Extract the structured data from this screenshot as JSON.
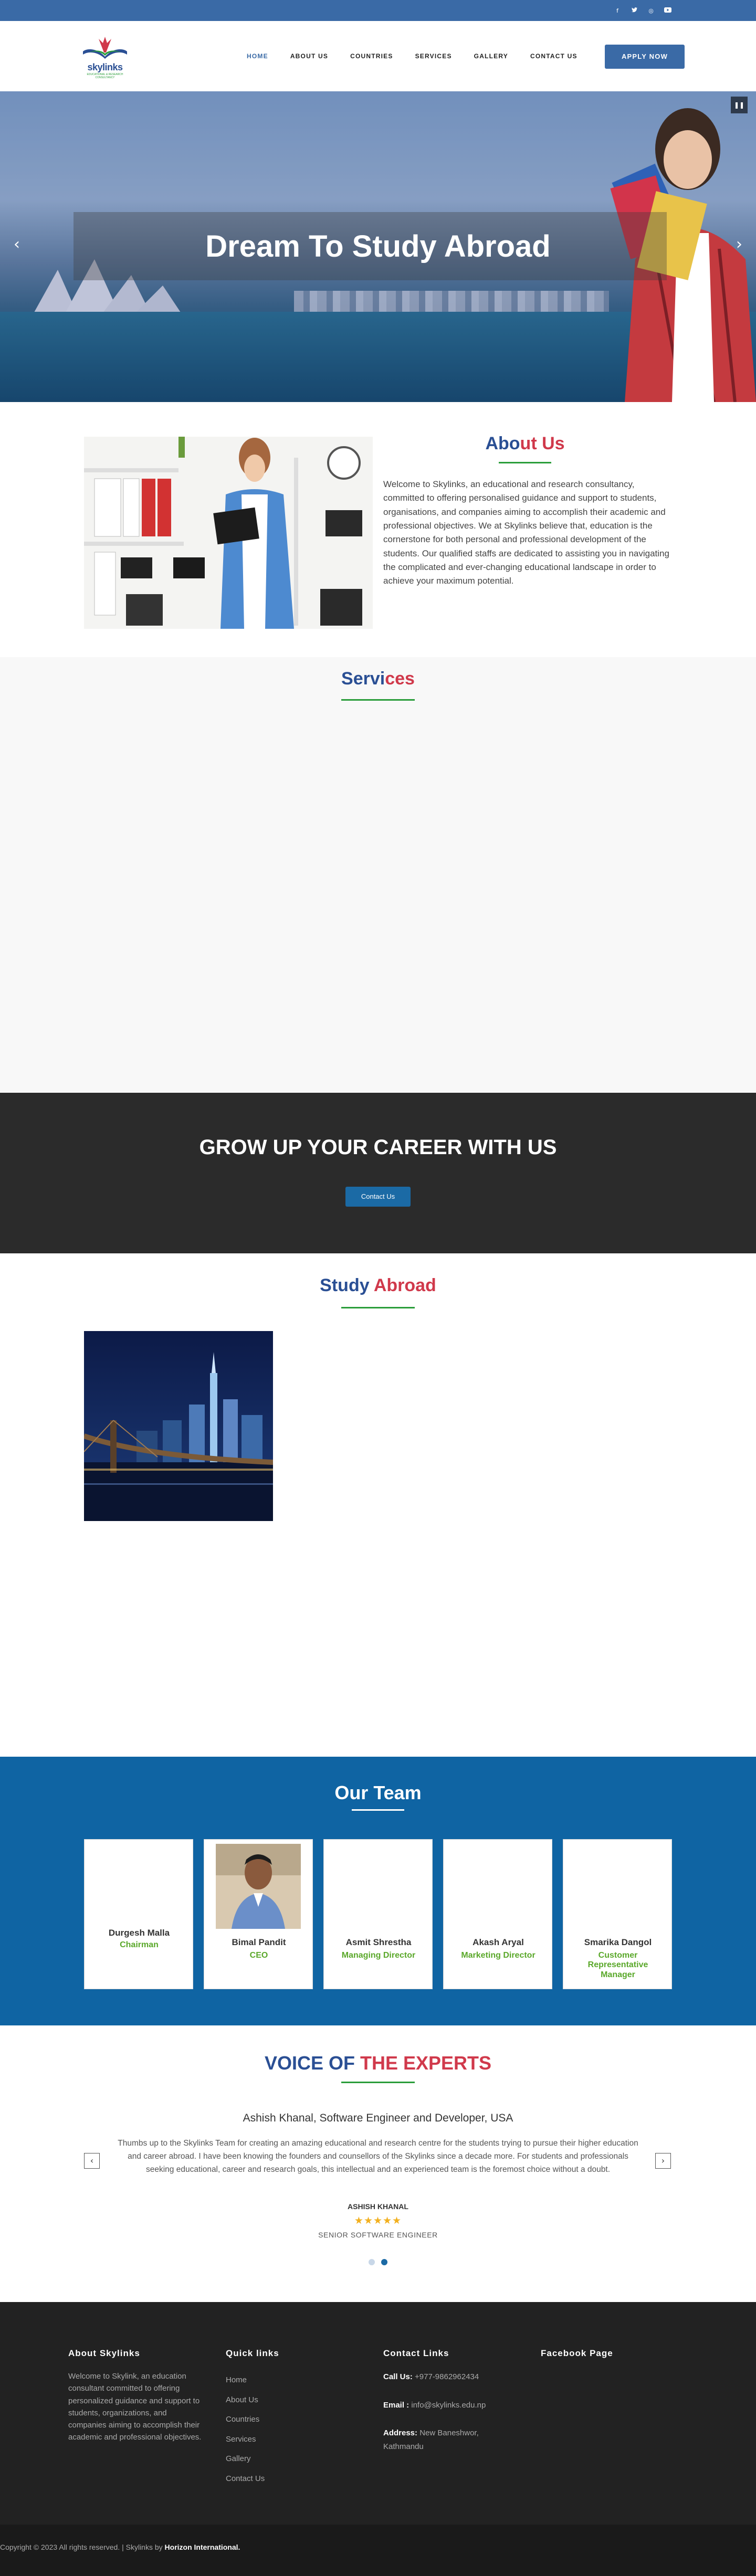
{
  "topbar": {
    "socials": [
      {
        "icon": "facebook-icon",
        "glyph": "f"
      },
      {
        "icon": "twitter-icon",
        "glyph": "🐦"
      },
      {
        "icon": "instagram-icon",
        "glyph": "◎"
      },
      {
        "icon": "youtube-icon",
        "glyph": "▶"
      }
    ]
  },
  "header": {
    "logo_text": "skylinks",
    "logo_subtext": "EDUCATIONAL & RESEARCH CONSULTANCY",
    "nav": [
      {
        "label": "HOME"
      },
      {
        "label": "ABOUT US"
      },
      {
        "label": "COUNTRIES"
      },
      {
        "label": "SERVICES"
      },
      {
        "label": "GALLERY"
      },
      {
        "label": "CONTACT US"
      }
    ],
    "apply_label": "APPLY NOW"
  },
  "hero": {
    "title": "Dream To Study Abroad",
    "prev_glyph": "‹",
    "next_glyph": "›",
    "pause_glyph": "❚❚"
  },
  "about": {
    "title_a": "Abo",
    "title_b": "ut Us",
    "text": "Welcome to Skylinks, an educational and research consultancy, committed to offering personalised guidance and support to students, organisations, and companies aiming to accomplish their academic and professional objectives. We at Skylinks believe that, education is the cornerstone for both personal and professional development of the students. Our qualified staffs are dedicated to assisting you in navigating the complicated and ever-changing educational landscape in order to achieve your maximum potential."
  },
  "services": {
    "title_a": "Servi",
    "title_b": "ces"
  },
  "cta": {
    "title": "GROW UP YOUR CAREER WITH US",
    "button": "Contact Us"
  },
  "study": {
    "title_a": "Study ",
    "title_b": "Abroad"
  },
  "team": {
    "title": "Our Team",
    "members": [
      {
        "name": "Durgesh Malla",
        "role": "Chairman"
      },
      {
        "name": "Bimal Pandit",
        "role": "CEO"
      },
      {
        "name": "Asmit Shrestha",
        "role": "Managing Director"
      },
      {
        "name": "Akash Aryal",
        "role": "Marketing Director"
      },
      {
        "name": "Smarika Dangol",
        "role": "Customer Representative Manager"
      }
    ]
  },
  "voice": {
    "title_a": "VOICE OF ",
    "title_b": "THE EXPERTS",
    "name": "Ashish Khanal, Software Engineer and Developer, USA",
    "text": "Thumbs up to the Skylinks Team for creating an amazing educational and research centre for the students trying to pursue their higher education and career abroad. I have been knowing the founders and counsellors of the Skylinks since a decade more. For students and professionals seeking educational, career and research goals, this intellectual and an experienced team is the foremost choice without a doubt.",
    "author": "ASHISH KHANAL",
    "stars": "★★★★★",
    "rating": 5,
    "position": "SENIOR SOFTWARE ENGINEER",
    "prev_glyph": "‹",
    "next_glyph": "›"
  },
  "footer": {
    "about_title": "About Skylinks",
    "about_text": "Welcome to Skylink, an education consultant committed to offering personalized guidance and support to students, organizations, and companies aiming to accomplish their academic and professional objectives.",
    "quick_title": "Quick links",
    "quick_links": [
      "Home",
      "About Us",
      "Countries",
      "Services",
      "Gallery",
      "Contact Us"
    ],
    "contact_title": "Contact Links",
    "call_label": "Call Us:",
    "call_value": " +977-9862962434",
    "email_label": "Email :",
    "email_value": " info@skylinks.edu.np",
    "address_label": "Address:",
    "address_value": " New Baneshwor, Kathmandu",
    "fb_title": "Facebook Page",
    "copyright": "Copyright © 2023 All rights reserved. | Skylinks by ",
    "copyright_brand": "Horizon International."
  },
  "colors": {
    "brand_blue": "#3a6aa6",
    "accent_red": "#d0394b",
    "accent_green": "#2a9d3a",
    "team_bg": "#0f64a3",
    "footer_bg": "#222222"
  }
}
